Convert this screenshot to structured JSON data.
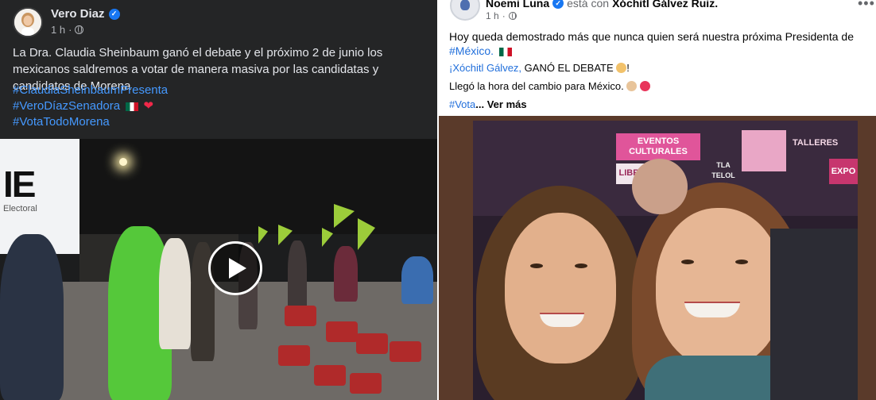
{
  "left_post": {
    "author": "Vero Diaz",
    "time": "1 h",
    "body": "La Dra. Claudia Sheinbaum ganó el debate y el próximo 2 de junio los mexicanos saldremos a votar de manera masiva por las candidatas y candidatos de Morena",
    "hashtags": [
      "#ClaudiaSheinbaumPresenta",
      "#VeroDíazSenadora",
      "#VotaTodoMorena"
    ],
    "video_sign_text": "IE",
    "video_sign_subtext": "Electoral"
  },
  "right_post": {
    "author": "Noemi Luna",
    "with_text": "está con",
    "tagged": "Xóchitl Gálvez Ruiz.",
    "time": "1 h",
    "line1": "Hoy queda demostrado más que nunca quien será nuestra próxima Presidenta de",
    "line2_link": "#México.",
    "line3_link": "¡Xóchitl Gálvez,",
    "line3_rest": " GANÓ EL DEBATE",
    "line3_end": "!",
    "line4": "Llegó la hora del cambio para México.",
    "line5_link": "#Vota",
    "line5_more": "... Ver más",
    "sign_eventos": "EVENTOS CULTURALES",
    "sign_talleres": "TALLERES",
    "sign_tlatelolco": "TLA TELOL CO",
    "sign_libre": "LIBRE",
    "sign_expo": "EXPO"
  },
  "colors": {
    "dark_bg": "#242526",
    "link_blue_dark": "#4599ff",
    "link_blue_light": "#216fdb",
    "verified": "#1877f2"
  },
  "icons": [
    "verified-badge-icon",
    "globe-icon",
    "more-options-icon",
    "play-icon",
    "mexico-flag-icon",
    "heart-icon"
  ]
}
